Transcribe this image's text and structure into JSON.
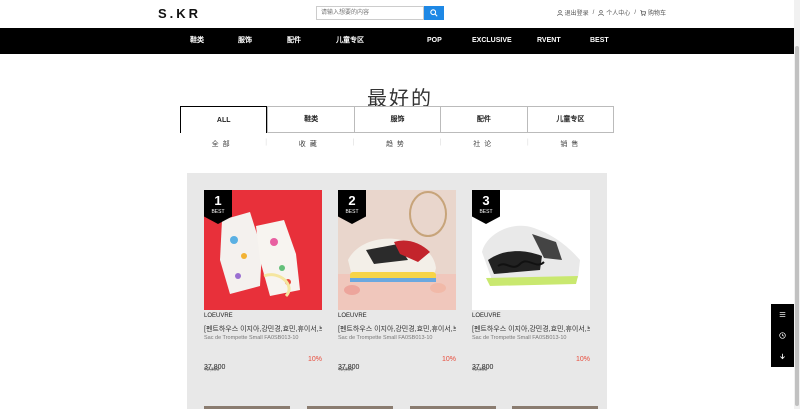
{
  "header": {
    "logo": "S.KR",
    "search_placeholder": "请输入想要的内容",
    "links": [
      "退出登录",
      "个人中心",
      "购物车"
    ],
    "separator": "/"
  },
  "nav": {
    "items": [
      "鞋类",
      "服饰",
      "配件",
      "儿童专区",
      "POP",
      "EXCLUSIVE",
      "RVENT",
      "BEST"
    ]
  },
  "section": {
    "title": "最好的",
    "tabs": [
      "ALL",
      "鞋类",
      "服饰",
      "配件",
      "儿童专区"
    ],
    "active_tab": "ALL",
    "subnav": [
      "全部",
      "收藏",
      "趋势",
      "社论",
      "销售"
    ]
  },
  "products": [
    {
      "rank": "1",
      "badge": "BEST",
      "brand": "LOEUVRE",
      "name": "[펜트하우스 이지아,강민경,효민,휴이서,브라...",
      "sub": "Sac de Trompette Small FA0SB013-10",
      "price": "37,800",
      "original_price": "42,000",
      "discount": "10%",
      "image_bg": "#e8303a"
    },
    {
      "rank": "2",
      "badge": "BEST",
      "brand": "LOEUVRE",
      "name": "[펜트하우스 이지아,강민경,효민,휴이서,브라...",
      "sub": "Sac de Trompette Small FA0SB013-10",
      "price": "37,800",
      "original_price": "42,000",
      "discount": "10%",
      "image_bg": "#e9d6cc"
    },
    {
      "rank": "3",
      "badge": "BEST",
      "brand": "LOEUVRE",
      "name": "[펜트하우스 이지아,강민경,효민,휴이서,브라...",
      "sub": "Sac de Trompette Small FA0SB013-10",
      "price": "37,800",
      "original_price": "42,000",
      "discount": "10%",
      "image_bg": "#ffffff"
    }
  ],
  "floatbar": {
    "icons": [
      "list-icon",
      "history-icon",
      "arrow-down-icon"
    ]
  }
}
